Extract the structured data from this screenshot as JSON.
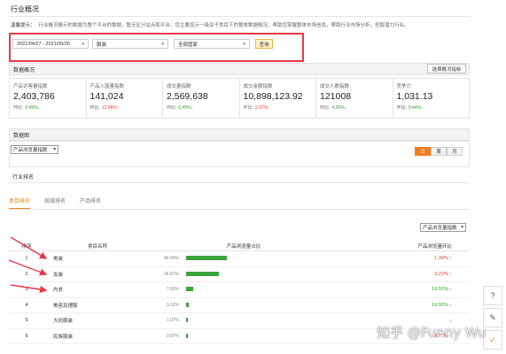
{
  "page": {
    "title": "行业概况",
    "notice_label": "温馨提示：",
    "notice_text": "行业概况展示的数据为整个平台的数据，暂无区分站点和平台，您主要显示一级及子类目下的整体数据概况，帮助您掌握整体市场信息，帮助行业市场分析，挖掘潜力行业。"
  },
  "filters": {
    "date_range": "2021/04/27 - 2021/05/26",
    "category": "服装",
    "region": "全部国家",
    "query_label": "查询"
  },
  "overview": {
    "heading": "数据概况",
    "pick_metrics_label": "选择概况指标",
    "metrics": [
      {
        "label": "产品访客量指数",
        "value": "2,403,786",
        "change_label": "环比:",
        "change": "0.45%",
        "direction": "down"
      },
      {
        "label": "产品入篮量指数",
        "value": "141,024",
        "change_label": "环比:",
        "change": "12.06%",
        "direction": "up"
      },
      {
        "label": "成交量指数",
        "value": "2,569,638",
        "change_label": "环比:",
        "change": "0.45%",
        "direction": "down"
      },
      {
        "label": "成交金额指数",
        "value": "10,898,123.92",
        "change_label": "环比:",
        "change": "2.97%",
        "direction": "up"
      },
      {
        "label": "成交人数指数",
        "value": "121008",
        "change_label": "环比:",
        "change": "4.06%",
        "direction": "down"
      },
      {
        "label": "竞争力",
        "value": "1,031.13",
        "change_label": "环比:",
        "change": "0.44%",
        "direction": "down"
      }
    ]
  },
  "trend": {
    "heading": "数据图",
    "metric_select": "产品浏览量指数",
    "buttons": [
      "日",
      "周",
      "月"
    ],
    "active": "日"
  },
  "ranking": {
    "heading": "行业排名",
    "tabs": [
      "类目排名",
      "局域排名",
      "产品排名"
    ],
    "active_tab": "类目排名",
    "sort_select": "产品浏览量指数",
    "columns": [
      "排序",
      "类目名称",
      "产品浏览量占比",
      "产品浏览量环比"
    ],
    "rows": [
      {
        "rank": "1",
        "name": "男装",
        "pct": "46.49%",
        "bar": 0.46,
        "change": "1.30%",
        "direction": "up"
      },
      {
        "rank": "2",
        "name": "女装",
        "pct": "36.87%",
        "bar": 0.37,
        "change": "3.22%",
        "direction": "up"
      },
      {
        "rank": "3",
        "name": "内衣",
        "pct": "7.65%",
        "bar": 0.076,
        "change": "10.01%",
        "direction": "down"
      },
      {
        "rank": "4",
        "name": "美容及理服",
        "pct": "3.12%",
        "bar": 0.031,
        "change": "10.92%",
        "direction": "down"
      },
      {
        "rank": "5",
        "name": "大码服装",
        "pct": "1.07%",
        "bar": 0.011,
        "change": "",
        "direction": "down"
      },
      {
        "rank": "6",
        "name": "民族服装",
        "pct": "0.87%",
        "bar": 0.009,
        "change": "8.77%",
        "direction": "up"
      }
    ]
  },
  "side": {
    "icons": [
      "help-icon",
      "edit-icon",
      "check-icon"
    ]
  },
  "watermark": "知乎 @Funny Wu",
  "colors": {
    "accent": "#f47a20",
    "bar_green": "#3aa33a",
    "up_red": "#e53935",
    "down_green": "#2e9a2e",
    "highlight_border": "#e63946"
  }
}
